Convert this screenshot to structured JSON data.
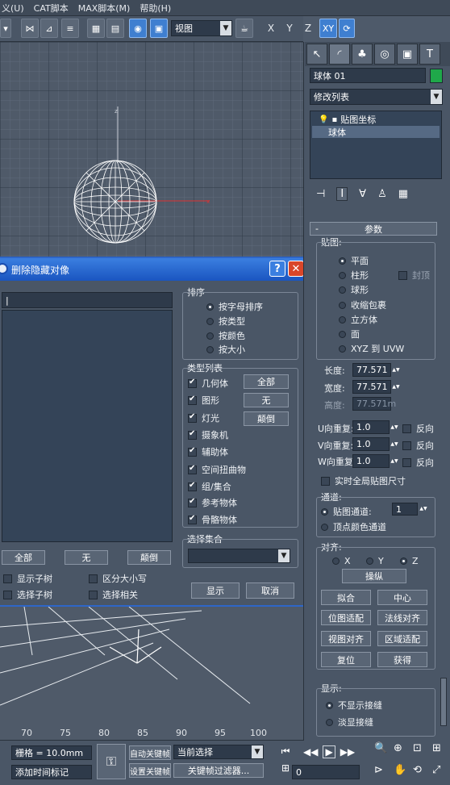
{
  "menu": [
    "义(U)",
    "CAT脚本",
    "MAX脚本(M)",
    "帮助(H)"
  ],
  "toolbar": {
    "view_select": "视图",
    "axes": [
      "X",
      "Y",
      "Z",
      "XY"
    ]
  },
  "command_panel": {
    "object_name": "球体 01",
    "object_color": "#1fa84a",
    "modifier_list": "修改列表",
    "stack": [
      "贴图坐标",
      "球体"
    ],
    "rollout_title": "参数",
    "mapping": {
      "title": "贴图:",
      "options": [
        "平面",
        "柱形",
        "球形",
        "收缩包裹",
        "立方体",
        "面",
        "XYZ 到 UVW"
      ],
      "selected": 0,
      "cap_label": "封顶"
    },
    "dims": {
      "length_label": "长度:",
      "length_value": "77.571",
      "width_label": "宽度:",
      "width_value": "77.571",
      "height_label": "高度:",
      "height_value": "77.571m"
    },
    "tiles": [
      {
        "label": "U向重复:",
        "value": "1.0",
        "flip": "反向"
      },
      {
        "label": "V向重复:",
        "value": "1.0",
        "flip": "反向"
      },
      {
        "label": "W向重复:",
        "value": "1.0",
        "flip": "反向"
      }
    ],
    "real_world": "实时全局贴图尺寸",
    "channel": {
      "title": "通道:",
      "map_channel": "贴图通道:",
      "map_channel_value": "1",
      "vertex_color": "顶点颜色通道"
    },
    "align": {
      "title": "对齐:",
      "axes": [
        "X",
        "Y",
        "Z"
      ],
      "selected_axis": 2,
      "flip_btn": "操纵",
      "buttons": [
        "拟合",
        "中心",
        "位图适配",
        "法线对齐",
        "视图对齐",
        "区域适配",
        "复位",
        "获得"
      ]
    },
    "display": {
      "title": "显示:",
      "options": [
        "不显示接缝",
        "淡显接缝"
      ],
      "selected": 0
    }
  },
  "dialog": {
    "title": "删除隐藏对像",
    "sort": {
      "title": "排序",
      "options": [
        "按字母排序",
        "按类型",
        "按颜色",
        "按大小"
      ],
      "selected": 0
    },
    "types": {
      "title": "类型列表",
      "items": [
        "几何体",
        "图形",
        "灯光",
        "摄象机",
        "辅助体",
        "空间扭曲物",
        "组/集合",
        "参考物体",
        "骨骼物体"
      ],
      "buttons": [
        "全部",
        "无",
        "颠倒"
      ]
    },
    "selection_set": {
      "title": "选择集合",
      "value": ""
    },
    "list_buttons": [
      "全部",
      "无",
      "颠倒"
    ],
    "checks": [
      "显示子树",
      "区分大小写",
      "选择子树",
      "选择相关"
    ],
    "ok": "显示",
    "cancel": "取消"
  },
  "timeline": {
    "ticks": [
      "70",
      "75",
      "80",
      "85",
      "90",
      "95",
      "100"
    ]
  },
  "status": {
    "grid": "栅格 = 10.0mm",
    "add_time_tag": "添加时间标记",
    "auto_key": "自动关键帧",
    "set_key": "设置关键帧",
    "selection_dropdown": "当前选择",
    "key_filters": "关键帧过滤器...",
    "frame_value": "0"
  }
}
